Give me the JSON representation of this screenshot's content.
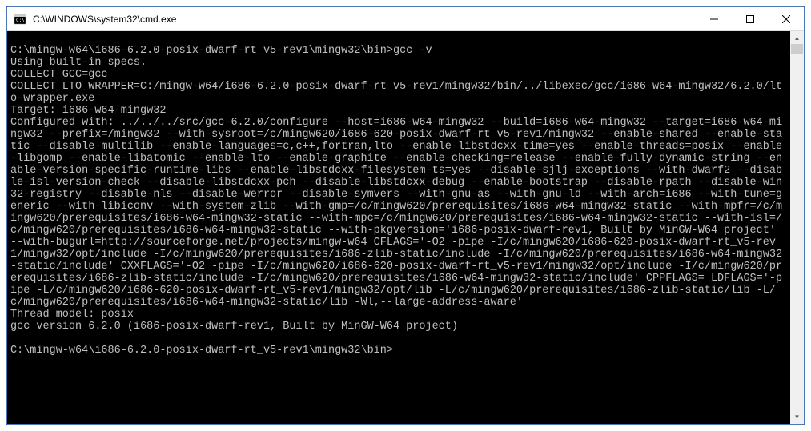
{
  "window": {
    "title": "C:\\WINDOWS\\system32\\cmd.exe"
  },
  "terminal": {
    "lines": [
      "",
      "C:\\mingw-w64\\i686-6.2.0-posix-dwarf-rt_v5-rev1\\mingw32\\bin>gcc -v",
      "Using built-in specs.",
      "COLLECT_GCC=gcc",
      "COLLECT_LTO_WRAPPER=C:/mingw-w64/i686-6.2.0-posix-dwarf-rt_v5-rev1/mingw32/bin/../libexec/gcc/i686-w64-mingw32/6.2.0/lto-wrapper.exe",
      "Target: i686-w64-mingw32",
      "Configured with: ../../../src/gcc-6.2.0/configure --host=i686-w64-mingw32 --build=i686-w64-mingw32 --target=i686-w64-mingw32 --prefix=/mingw32 --with-sysroot=/c/mingw620/i686-620-posix-dwarf-rt_v5-rev1/mingw32 --enable-shared --enable-static --disable-multilib --enable-languages=c,c++,fortran,lto --enable-libstdcxx-time=yes --enable-threads=posix --enable-libgomp --enable-libatomic --enable-lto --enable-graphite --enable-checking=release --enable-fully-dynamic-string --enable-version-specific-runtime-libs --enable-libstdcxx-filesystem-ts=yes --disable-sjlj-exceptions --with-dwarf2 --disable-isl-version-check --disable-libstdcxx-pch --disable-libstdcxx-debug --enable-bootstrap --disable-rpath --disable-win32-registry --disable-nls --disable-werror --disable-symvers --with-gnu-as --with-gnu-ld --with-arch=i686 --with-tune=generic --with-libiconv --with-system-zlib --with-gmp=/c/mingw620/prerequisites/i686-w64-mingw32-static --with-mpfr=/c/mingw620/prerequisites/i686-w64-mingw32-static --with-mpc=/c/mingw620/prerequisites/i686-w64-mingw32-static --with-isl=/c/mingw620/prerequisites/i686-w64-mingw32-static --with-pkgversion='i686-posix-dwarf-rev1, Built by MinGW-W64 project' --with-bugurl=http://sourceforge.net/projects/mingw-w64 CFLAGS='-O2 -pipe -I/c/mingw620/i686-620-posix-dwarf-rt_v5-rev1/mingw32/opt/include -I/c/mingw620/prerequisites/i686-zlib-static/include -I/c/mingw620/prerequisites/i686-w64-mingw32-static/include' CXXFLAGS='-O2 -pipe -I/c/mingw620/i686-620-posix-dwarf-rt_v5-rev1/mingw32/opt/include -I/c/mingw620/prerequisites/i686-zlib-static/include -I/c/mingw620/prerequisites/i686-w64-mingw32-static/include' CPPFLAGS= LDFLAGS='-pipe -L/c/mingw620/i686-620-posix-dwarf-rt_v5-rev1/mingw32/opt/lib -L/c/mingw620/prerequisites/i686-zlib-static/lib -L/c/mingw620/prerequisites/i686-w64-mingw32-static/lib -Wl,--large-address-aware'",
      "Thread model: posix",
      "gcc version 6.2.0 (i686-posix-dwarf-rev1, Built by MinGW-W64 project)",
      "",
      "C:\\mingw-w64\\i686-6.2.0-posix-dwarf-rt_v5-rev1\\mingw32\\bin>"
    ]
  }
}
